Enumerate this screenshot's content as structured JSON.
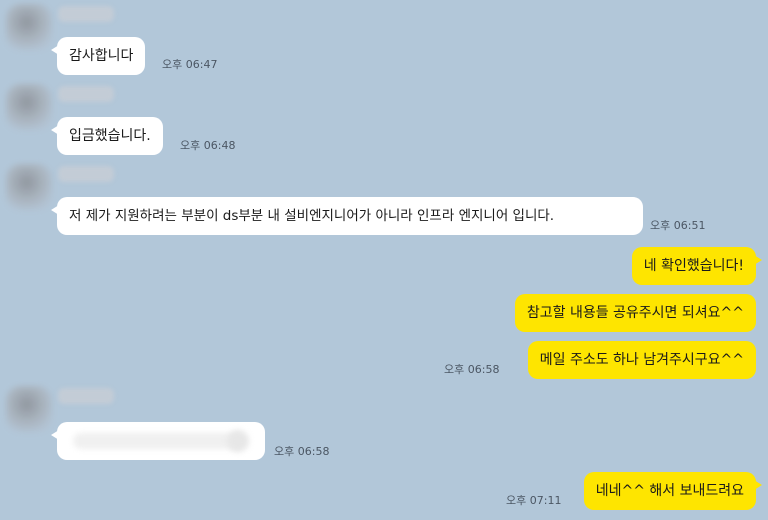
{
  "messages": [
    {
      "side": "in",
      "text": "감사합니다",
      "time": "오후 06:47"
    },
    {
      "side": "in",
      "text": "입금했습니다.",
      "time": "오후 06:48"
    },
    {
      "side": "in",
      "text": "저 제가 지원하려는 부분이 ds부분 내 설비엔지니어가 아니라 인프라 엔지니어 입니다.",
      "time": "오후 06:51"
    },
    {
      "side": "out",
      "text": "네 확인했습니다!",
      "time": ""
    },
    {
      "side": "out",
      "text": "참고할 내용들 공유주시면 되셔요^^",
      "time": ""
    },
    {
      "side": "out",
      "text": "메일 주소도 하나 남겨주시구요^^",
      "time": "오후 06:58"
    },
    {
      "side": "in",
      "text": "",
      "time": "오후 06:58"
    },
    {
      "side": "out",
      "text": "네네^^ 해서 보내드려요",
      "time": "오후 07:11"
    }
  ]
}
